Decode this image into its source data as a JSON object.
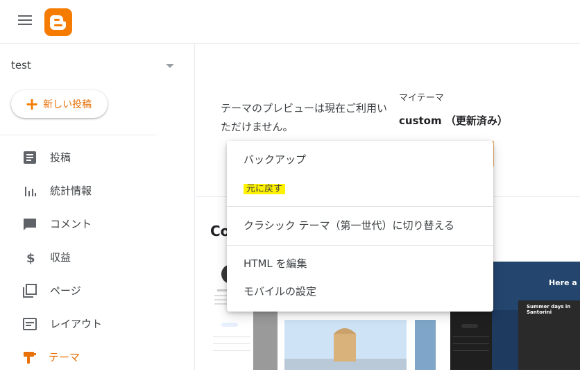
{
  "sidebar": {
    "blog_name": "test",
    "new_post_label": "新しい投稿",
    "items": [
      {
        "label": "投稿",
        "icon": "posts-icon"
      },
      {
        "label": "統計情報",
        "icon": "stats-icon"
      },
      {
        "label": "コメント",
        "icon": "comment-icon"
      },
      {
        "label": "収益",
        "icon": "dollar-icon"
      },
      {
        "label": "ページ",
        "icon": "pages-icon"
      },
      {
        "label": "レイアウト",
        "icon": "layout-icon"
      },
      {
        "label": "テーマ",
        "icon": "theme-icon"
      }
    ],
    "active_item": "テーマ"
  },
  "main": {
    "preview_note": "テーマのプレビューは現在ご利用いただけません。",
    "my_theme_label": "マイテーマ",
    "theme_name": "custom （更新済み）",
    "section_title_partial": "Co"
  },
  "menu": {
    "items": [
      {
        "label": "バックアップ"
      },
      {
        "label": "元に戻す"
      },
      {
        "label": "クラシック テーマ（第一世代）に切り替える"
      },
      {
        "label": "HTML を編集"
      },
      {
        "label": "モバイルの設定"
      }
    ]
  },
  "thumbnails": {
    "dark_header_text": "Here a",
    "dark_post_title": "Summer days in Santorini"
  },
  "colors": {
    "brand": "#f57c00",
    "active_text": "#e8710a",
    "highlight": "#fff200"
  }
}
